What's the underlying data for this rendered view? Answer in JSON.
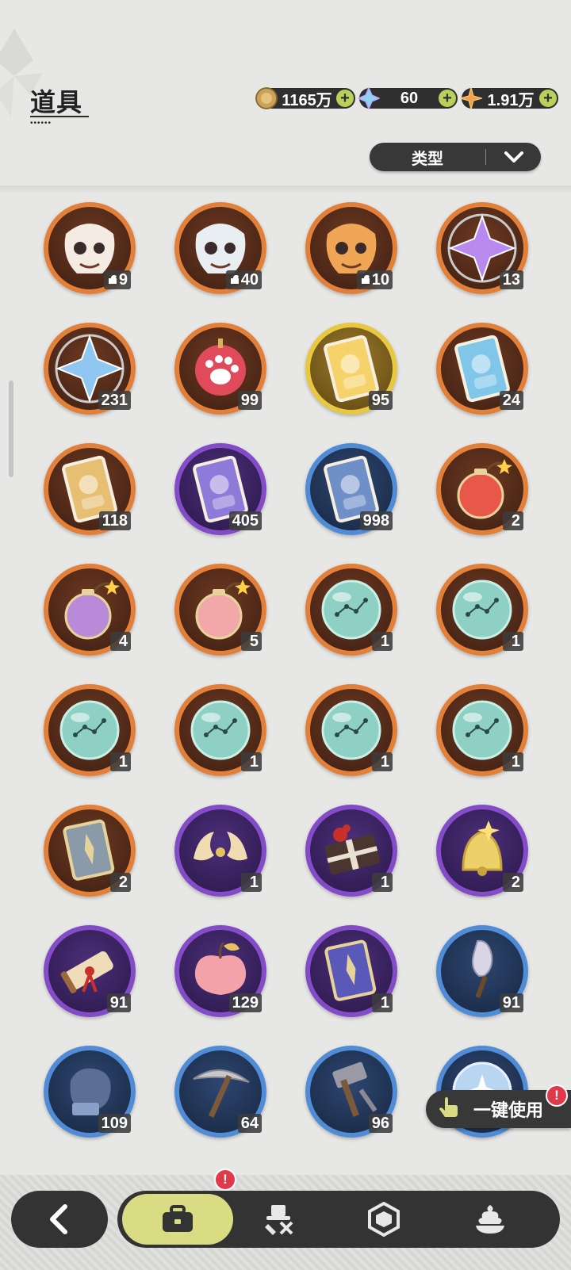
{
  "header": {
    "title": "道具",
    "title_dots": "••••••"
  },
  "currencies": [
    {
      "name": "gold-coin",
      "icon": "gold-coin-icon",
      "value": "1165万"
    },
    {
      "name": "crystal",
      "icon": "crystal-icon",
      "value": "60"
    },
    {
      "name": "star",
      "icon": "star-icon",
      "value": "1.91万"
    }
  ],
  "filter": {
    "label": "类型"
  },
  "items": [
    {
      "name": "cat-doll-red-fragment",
      "icon": "puppet-fragment-icon",
      "count": "9",
      "frag": true
    },
    {
      "name": "cat-doll-white-fragment",
      "icon": "puppet-fragment-icon",
      "count": "40",
      "frag": true
    },
    {
      "name": "tiger-cat-fragment",
      "icon": "puppet-fragment-icon",
      "count": "10",
      "frag": true
    },
    {
      "name": "purple-crystal",
      "icon": "crystal-icon",
      "count": "13"
    },
    {
      "name": "blue-crystal",
      "icon": "crystal-icon",
      "count": "231"
    },
    {
      "name": "paw-charm",
      "icon": "paw-icon",
      "count": "99"
    },
    {
      "name": "gold-card",
      "icon": "card-icon",
      "count": "95"
    },
    {
      "name": "rainbow-card",
      "icon": "card-icon",
      "count": "24"
    },
    {
      "name": "orange-card",
      "icon": "card-icon",
      "count": "118"
    },
    {
      "name": "purple-card",
      "icon": "card-icon",
      "count": "405"
    },
    {
      "name": "blue-card",
      "icon": "card-icon",
      "count": "998"
    },
    {
      "name": "red-bomb",
      "icon": "bomb-icon",
      "count": "2"
    },
    {
      "name": "purple-bomb",
      "icon": "bomb-icon",
      "count": "4"
    },
    {
      "name": "heart-bomb",
      "icon": "bomb-icon",
      "count": "5"
    },
    {
      "name": "constellation-orb-1",
      "icon": "orb-icon",
      "count": "1"
    },
    {
      "name": "constellation-orb-2",
      "icon": "orb-icon",
      "count": "1"
    },
    {
      "name": "constellation-orb-3",
      "icon": "orb-icon",
      "count": "1"
    },
    {
      "name": "constellation-orb-4",
      "icon": "orb-icon",
      "count": "1"
    },
    {
      "name": "constellation-orb-5",
      "icon": "orb-icon",
      "count": "1"
    },
    {
      "name": "constellation-orb-6",
      "icon": "orb-icon",
      "count": "1"
    },
    {
      "name": "rune-book",
      "icon": "book-icon",
      "count": "2"
    },
    {
      "name": "horn-mask",
      "icon": "horn-icon",
      "count": "1"
    },
    {
      "name": "gift-box",
      "icon": "gift-icon",
      "count": "1"
    },
    {
      "name": "golden-bell",
      "icon": "bell-icon",
      "count": "2"
    },
    {
      "name": "scroll",
      "icon": "scroll-icon",
      "count": "91"
    },
    {
      "name": "peach",
      "icon": "peach-icon",
      "count": "129"
    },
    {
      "name": "blue-tome",
      "icon": "book-icon",
      "count": "1"
    },
    {
      "name": "shovel",
      "icon": "shovel-icon",
      "count": "91"
    },
    {
      "name": "glove",
      "icon": "glove-icon",
      "count": "109"
    },
    {
      "name": "pickaxe",
      "icon": "pickaxe-icon",
      "count": "64"
    },
    {
      "name": "hammer",
      "icon": "hammer-icon",
      "count": "96"
    },
    {
      "name": "star-orb",
      "icon": "orb-icon",
      "count": ""
    }
  ],
  "one_key_use": {
    "label": "一键使用",
    "badge": "!"
  },
  "nav": {
    "tabs": [
      {
        "name": "tab-backpack",
        "icon": "briefcase-icon",
        "badge": "!"
      },
      {
        "name": "tab-equipment",
        "icon": "hat-tools-icon"
      },
      {
        "name": "tab-gems",
        "icon": "hexagon-gem-icon"
      },
      {
        "name": "tab-desserts",
        "icon": "cream-dessert-icon"
      }
    ]
  },
  "colors": {
    "rarity_orange": "#e07a33",
    "rarity_purple": "#7d44c4",
    "rarity_blue": "#4a86d3",
    "rarity_gold": "#e4c233",
    "nav_active": "#d9dc82",
    "plus_green": "#b9d05b",
    "badge_red": "#e0394a"
  }
}
